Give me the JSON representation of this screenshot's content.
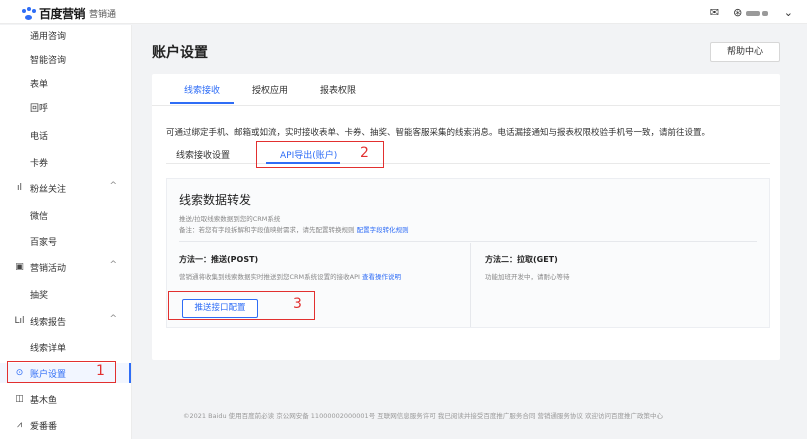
{
  "header": {
    "brand": "百度营销",
    "product": "营销通",
    "icons": [
      "mail-icon",
      "user-icon",
      "chevron-down-icon"
    ]
  },
  "sidebar": {
    "items": [
      {
        "label": "通用咨询",
        "type": "sub"
      },
      {
        "label": "智能咨询",
        "type": "sub"
      },
      {
        "label": "表单",
        "type": "sub"
      },
      {
        "label": "回呼",
        "type": "sub"
      },
      {
        "label": "电话",
        "type": "sub"
      },
      {
        "label": "卡券",
        "type": "sub"
      },
      {
        "label": "粉丝关注",
        "type": "section",
        "icon": "chart-icon"
      },
      {
        "label": "微信",
        "type": "sub"
      },
      {
        "label": "百家号",
        "type": "sub"
      },
      {
        "label": "营销活动",
        "type": "section",
        "icon": "activity-icon"
      },
      {
        "label": "抽奖",
        "type": "sub"
      },
      {
        "label": "线索报告",
        "type": "section",
        "icon": "report-icon"
      },
      {
        "label": "线索详单",
        "type": "sub"
      },
      {
        "label": "账户设置",
        "type": "section",
        "icon": "settings-icon",
        "active": true
      },
      {
        "label": "基木鱼",
        "type": "section",
        "icon": "fish-icon"
      },
      {
        "label": "爱番番",
        "type": "section",
        "icon": "aifanfan-icon"
      }
    ]
  },
  "main": {
    "title": "账户设置",
    "help_label": "帮助中心",
    "tabs": [
      "线索接收",
      "授权应用",
      "报表权限"
    ],
    "description": "可通过绑定手机、邮箱或如流，实时接收表单、卡券、抽奖、智能客服采集的线索消息。电话漏接通知与报表权限校验手机号一致，请前往设置。",
    "sub_tabs": [
      "线索接收设置",
      "API导出(账户)"
    ],
    "panel": {
      "title": "线索数据转发",
      "note1": "推送/拉取线索数据到您的CRM系统",
      "note2_prefix": "备注：若您有字段拆解和字段值映射需求，请先配置转换规则",
      "note2_link": "配置字段转化规则",
      "method1_title": "方法一：推送(POST)",
      "method1_desc": "营销通将收集到线索数据实时推送到您CRM系统设置的接收API",
      "method1_link": "查看操作说明",
      "method2_title": "方法二：拉取(GET)",
      "method2_desc": "功能加班开发中，请耐心等待",
      "push_button": "推送接口配置"
    }
  },
  "annotations": [
    "1",
    "2",
    "3"
  ],
  "footer": "©2021 Baidu 使用百度前必读 京公网安备 11000002000001号 互联网信息服务许可 我已阅读并接受百度推广服务合同 营销通服务协议 欢迎访问百度推广政策中心",
  "colors": {
    "accent": "#2f6df6",
    "highlight": "#e2302f"
  }
}
